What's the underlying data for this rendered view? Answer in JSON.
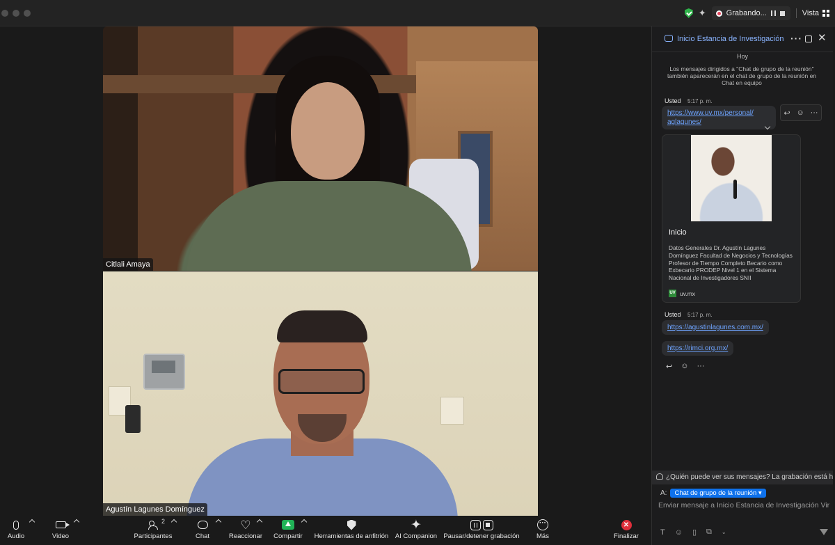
{
  "titlebar": {
    "recording_label": "Grabando...",
    "view_label": "Vista"
  },
  "videos": [
    {
      "name": "Citlali Amaya"
    },
    {
      "name": "Agustín Lagunes Domínguez"
    }
  ],
  "chat": {
    "title": "Inicio Estancia de Investigación Vir...",
    "day": "Hoy",
    "notice": "Los mensajes dirigidos a \"Chat de grupo de la reunión\" también aparecerán en el chat de grupo de la reunión en Chat en equipo",
    "messages": [
      {
        "sender": "Usted",
        "time": "5:17 p. m.",
        "link_line1": "https://www.uv.mx/personal/",
        "link_line2": "aglagunes/"
      },
      {
        "sender": "Usted",
        "time": "5:17 p. m.",
        "link": "https://agustinlagunes.com.mx/"
      },
      {
        "link": "https://rimci.org.mx/"
      }
    ],
    "preview": {
      "title": "Inicio",
      "description": "Datos Generales Dr. Agustín Lagunes Domínguez Facultad de Negocios y Tecnologías Profesor de Tiempo Completo Becario como Exbecario PRODEP Nivel 1 en el Sistema Nacional de Investigadores SNII",
      "logo_text": "UV",
      "host": "uv.mx"
    },
    "who_can_see": "¿Quién puede ver sus mensajes? La grabación está h...",
    "to_label": "A:",
    "recipient": "Chat de grupo de la reunión",
    "input_placeholder": "Enviar mensaje a Inicio Estancia de Investigación Vir..."
  },
  "toolbar": {
    "audio": "Audio",
    "video": "Video",
    "participants": "Participantes",
    "participants_count": "2",
    "chat": "Chat",
    "react": "Reaccionar",
    "share": "Compartir",
    "host_tools": "Herramientas de anfitrión",
    "ai": "AI Companion",
    "record": "Pausar/detener grabación",
    "more": "Más",
    "end": "Finalizar"
  },
  "colors": {
    "accent": "#0e71eb",
    "link": "#6ea4ff",
    "share_green": "#21b357",
    "end_red": "#e02f3b"
  },
  "icons": [
    "shield-check-icon",
    "sparkle-icon",
    "record-icon",
    "pause-icon",
    "stop-icon",
    "grid-icon",
    "chat-bubble-icon",
    "ellipsis-icon",
    "popout-icon",
    "close-icon",
    "reply-icon",
    "emoji-icon",
    "microphone-icon",
    "camera-icon",
    "participants-icon",
    "heart-icon",
    "share-icon",
    "host-shield-icon",
    "more-icon",
    "end-icon",
    "send-icon"
  ]
}
